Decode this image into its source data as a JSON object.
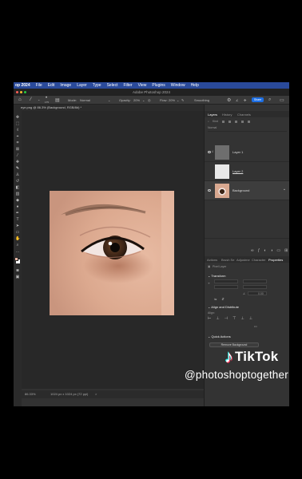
{
  "menubar": {
    "app_name": "op 2024",
    "items": [
      "File",
      "Edit",
      "Image",
      "Layer",
      "Type",
      "Select",
      "Filter",
      "View",
      "Plugins",
      "Window",
      "Help"
    ]
  },
  "window": {
    "title": "Adobe Photoshop 2024"
  },
  "options": {
    "mode_label": "Mode:",
    "mode_value": "Normal",
    "opacity_label": "Opacity:",
    "opacity_value": "20%",
    "flow_label": "Flow:",
    "flow_value": "20%",
    "smoothing_label": "Smoothing",
    "brush_size": "175",
    "share_label": "Share"
  },
  "document": {
    "tab_label": "eye.png @ 86.3% (Background, RGB/8#) *"
  },
  "status": {
    "zoom": "86.33%",
    "doc_info": "1024 px x 1024 px (72 ppi)",
    "arrow": ">"
  },
  "layers_panel": {
    "tabs": [
      "Layers",
      "History",
      "Channels"
    ],
    "search_label": "Kind",
    "mode_value": "Normal",
    "layers": [
      {
        "name": "Layer 1",
        "number": "4",
        "thumb_color": "#6e6e6e"
      },
      {
        "name": "Layer 2",
        "number": "",
        "thumb_color": "#e8e8e8"
      },
      {
        "name": "Background",
        "number": "",
        "thumb_color": "#d8a890"
      }
    ]
  },
  "properties_panel": {
    "tabs": [
      "Actions",
      "Brush Se",
      "Adjustme",
      "Character",
      "Properties"
    ],
    "pixel_layer_label": "Pixel Layer",
    "transform_label": "Transform",
    "transform_angle": "0.00",
    "align_label": "Align and Distribute",
    "align_sub": "Align:",
    "quick_actions_label": "Quick Actions",
    "remove_bg_label": "Remove Background"
  },
  "watermark": {
    "brand": "TikTok",
    "handle": "@photoshoptogether"
  },
  "colors": {
    "accent": "#1d6fe5",
    "menubar": "#2a4a9a",
    "panel": "#333333",
    "canvas": "#282828",
    "foreground_swatch": "#e9b6a3",
    "background_swatch": "#ffffff"
  }
}
